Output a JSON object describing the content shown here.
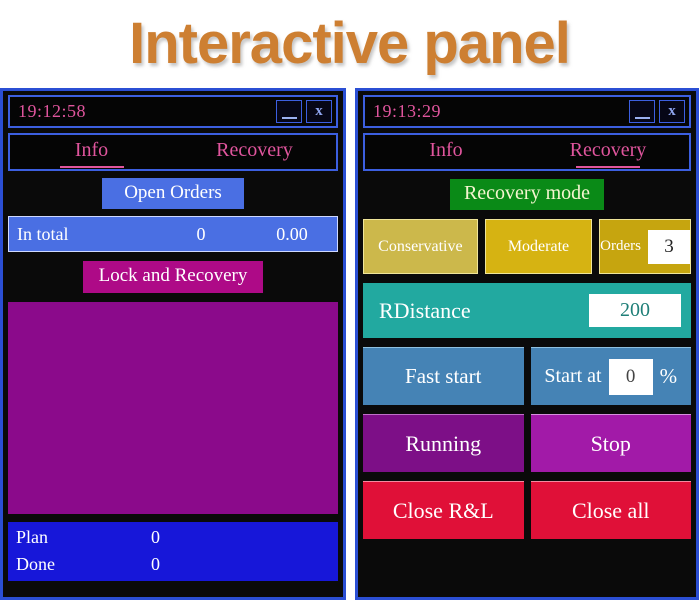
{
  "page": {
    "title": "Interactive panel",
    "title_color": "#cd7f32",
    "background": "#ffffff"
  },
  "left_panel": {
    "titlebar": {
      "clock": "19:12:58",
      "minimize_label": "_",
      "close_label": "x"
    },
    "tabs": [
      {
        "label": "Info",
        "active": true
      },
      {
        "label": "Recovery",
        "active": false
      }
    ],
    "open_orders_label": "Open Orders",
    "in_total": {
      "label": "In total",
      "count": "0",
      "amount": "0.00"
    },
    "lock_and_recovery_label": "Lock and Recovery",
    "orders_list_color": "#8b0a8b",
    "footer": {
      "plan_label": "Plan",
      "plan_value": "0",
      "done_label": "Done",
      "done_value": "0"
    }
  },
  "right_panel": {
    "titlebar": {
      "clock": "19:13:29",
      "minimize_label": "_",
      "close_label": "x"
    },
    "tabs": [
      {
        "label": "Info",
        "active": false
      },
      {
        "label": "Recovery",
        "active": true
      }
    ],
    "recovery_mode_label": "Recovery mode",
    "mode_buttons": [
      {
        "label": "Conservative",
        "color": "#ccb84b"
      },
      {
        "label": "Moderate",
        "color": "#d6b312"
      }
    ],
    "orders": {
      "label": "Orders",
      "value": "3"
    },
    "rdistance": {
      "label": "RDistance",
      "value": "200",
      "color": "#22a9a0"
    },
    "fast_start_label": "Fast start",
    "start_at": {
      "label": "Start at",
      "value": "0",
      "unit": "%"
    },
    "running_label": "Running",
    "stop_label": "Stop",
    "close_rl_label": "Close R&L",
    "close_all_label": "Close all"
  }
}
